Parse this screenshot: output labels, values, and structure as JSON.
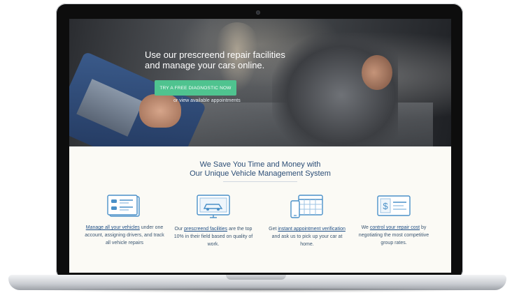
{
  "hero": {
    "title_line1": "Use our prescreend repair facilities",
    "title_line2": "and manage your cars online.",
    "cta_label": "TRY A FREE DIAGNOSTIC NOW",
    "secondary_link": "or view available appointments"
  },
  "section": {
    "title_line1": "We Save You Time and Money with",
    "title_line2": "Our Unique Vehicle Management System"
  },
  "features": [
    {
      "icon": "vehicle-list-icon",
      "link": "Manage all your vehicles",
      "text_after": " under one account, assigning drivers, and track all vehicle repairs",
      "text_before": ""
    },
    {
      "icon": "car-monitor-icon",
      "text_before": "Our ",
      "link": "prescreend facilities",
      "text_after": " are the top 10% in their field based on quality of work."
    },
    {
      "icon": "calendar-phone-icon",
      "text_before": "Get ",
      "link": "instant appointment verification",
      "text_after": " and ask us to pick up your car at home."
    },
    {
      "icon": "dollar-card-icon",
      "text_before": "We ",
      "link": "control your repair cost",
      "text_after": " by negotiating the most competitive group rates."
    }
  ],
  "colors": {
    "accent": "#4fc38f",
    "heading": "#2b4d76",
    "link": "#1f4f86",
    "icon": "#4a90c8"
  }
}
